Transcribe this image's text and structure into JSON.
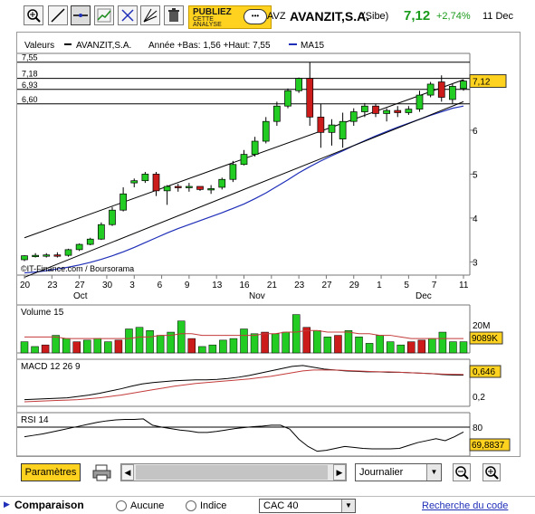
{
  "toolbar": {
    "tools": [
      {
        "name": "zoom-tool"
      },
      {
        "name": "line-tool"
      },
      {
        "name": "horizontal-line-tool"
      },
      {
        "name": "trend-tool"
      },
      {
        "name": "crosshair-tool"
      },
      {
        "name": "fibonacci-tool"
      },
      {
        "name": "delete-tool"
      }
    ],
    "publish_line1": "PUBLIEZ",
    "publish_line2": "CETTE",
    "publish_line3": "ANALYSE"
  },
  "stock": {
    "ticker": "AVZ",
    "name": "AVANZIT,S.A.",
    "market": "(Sibe)",
    "price": "7,12",
    "change": "+2,74%",
    "date": "11 Dec"
  },
  "colors": {
    "up_candle": "#22cc22",
    "down_candle": "#cc1b1b",
    "ma_line": "#1f2fb8",
    "channel_line": "#000000",
    "price_tag": "#ffd21f",
    "volume_ma": "#c43b3b",
    "macd_signal": "#c43b3b"
  },
  "price_panel": {
    "legend_valeurs": "Valeurs",
    "legend_series": "AVANZIT,S.A.",
    "legend_range": "Année +Bas: 1,56 +Haut: 7,55",
    "legend_ma": "MA15",
    "level_labels": [
      "7,55",
      "7,18",
      "6,93",
      "6,60"
    ],
    "y_ticks": [
      "6",
      "5",
      "4",
      "3"
    ],
    "price_tag": "7,12",
    "copyright": "©IT-Finance.com / Boursorama"
  },
  "x_axis": {
    "ticks": [
      "20",
      "23",
      "27",
      "30",
      "3",
      "6",
      "9",
      "13",
      "16",
      "21",
      "23",
      "27",
      "29",
      "1",
      "5",
      "7",
      "11"
    ],
    "months": [
      "Oct",
      "Nov",
      "Dec"
    ]
  },
  "chart_data": {
    "type": "candlestick",
    "title": "AVANZIT,S.A.",
    "candles": [
      {
        "o": 3.05,
        "h": 3.15,
        "l": 3.02,
        "c": 3.14
      },
      {
        "o": 3.14,
        "h": 3.2,
        "l": 3.1,
        "c": 3.15
      },
      {
        "o": 3.15,
        "h": 3.2,
        "l": 3.1,
        "c": 3.16
      },
      {
        "o": 3.16,
        "h": 3.22,
        "l": 3.1,
        "c": 3.15
      },
      {
        "o": 3.15,
        "h": 3.3,
        "l": 3.12,
        "c": 3.28
      },
      {
        "o": 3.28,
        "h": 3.42,
        "l": 3.25,
        "c": 3.4
      },
      {
        "o": 3.4,
        "h": 3.55,
        "l": 3.38,
        "c": 3.52
      },
      {
        "o": 3.52,
        "h": 3.9,
        "l": 3.5,
        "c": 3.85
      },
      {
        "o": 3.85,
        "h": 4.25,
        "l": 3.82,
        "c": 4.18
      },
      {
        "o": 4.18,
        "h": 4.7,
        "l": 4.15,
        "c": 4.55
      },
      {
        "o": 4.8,
        "h": 4.9,
        "l": 4.7,
        "c": 4.85
      },
      {
        "o": 4.85,
        "h": 5.05,
        "l": 4.8,
        "c": 5.0
      },
      {
        "o": 5.0,
        "h": 5.05,
        "l": 4.5,
        "c": 4.62
      },
      {
        "o": 4.62,
        "h": 4.75,
        "l": 4.3,
        "c": 4.72
      },
      {
        "o": 4.72,
        "h": 4.78,
        "l": 4.6,
        "c": 4.71
      },
      {
        "o": 4.71,
        "h": 4.8,
        "l": 4.6,
        "c": 4.72
      },
      {
        "o": 4.72,
        "h": 4.72,
        "l": 4.62,
        "c": 4.65
      },
      {
        "o": 4.65,
        "h": 4.75,
        "l": 4.55,
        "c": 4.67
      },
      {
        "o": 4.7,
        "h": 4.92,
        "l": 4.65,
        "c": 4.88
      },
      {
        "o": 4.88,
        "h": 5.3,
        "l": 4.82,
        "c": 5.22
      },
      {
        "o": 5.22,
        "h": 5.55,
        "l": 5.2,
        "c": 5.45
      },
      {
        "o": 5.45,
        "h": 5.85,
        "l": 5.4,
        "c": 5.75
      },
      {
        "o": 5.75,
        "h": 6.3,
        "l": 5.7,
        "c": 6.2
      },
      {
        "o": 6.2,
        "h": 6.65,
        "l": 6.1,
        "c": 6.55
      },
      {
        "o": 6.55,
        "h": 6.95,
        "l": 6.5,
        "c": 6.9
      },
      {
        "o": 6.9,
        "h": 7.2,
        "l": 6.85,
        "c": 7.18
      },
      {
        "o": 7.18,
        "h": 7.55,
        "l": 6.1,
        "c": 6.3
      },
      {
        "o": 6.3,
        "h": 6.6,
        "l": 5.6,
        "c": 5.95
      },
      {
        "o": 5.95,
        "h": 6.25,
        "l": 5.65,
        "c": 6.12
      },
      {
        "o": 5.8,
        "h": 6.4,
        "l": 5.6,
        "c": 6.2
      },
      {
        "o": 6.2,
        "h": 6.5,
        "l": 6.1,
        "c": 6.42
      },
      {
        "o": 6.42,
        "h": 6.62,
        "l": 6.3,
        "c": 6.55
      },
      {
        "o": 6.55,
        "h": 6.6,
        "l": 6.3,
        "c": 6.38
      },
      {
        "o": 6.38,
        "h": 6.5,
        "l": 6.2,
        "c": 6.45
      },
      {
        "o": 6.45,
        "h": 6.55,
        "l": 6.3,
        "c": 6.4
      },
      {
        "o": 6.4,
        "h": 6.55,
        "l": 6.35,
        "c": 6.48
      },
      {
        "o": 6.48,
        "h": 6.9,
        "l": 6.42,
        "c": 6.8
      },
      {
        "o": 6.8,
        "h": 7.1,
        "l": 6.75,
        "c": 7.05
      },
      {
        "o": 7.1,
        "h": 7.25,
        "l": 6.65,
        "c": 6.75
      },
      {
        "o": 6.7,
        "h": 7.05,
        "l": 6.6,
        "c": 7.0
      },
      {
        "o": 6.95,
        "h": 7.15,
        "l": 6.9,
        "c": 7.12
      }
    ],
    "ma15": [
      2.75,
      2.77,
      2.8,
      2.84,
      2.88,
      2.93,
      2.99,
      3.06,
      3.14,
      3.23,
      3.33,
      3.44,
      3.55,
      3.66,
      3.76,
      3.85,
      3.94,
      4.03,
      4.12,
      4.22,
      4.32,
      4.44,
      4.57,
      4.72,
      4.87,
      5.03,
      5.17,
      5.3,
      5.42,
      5.53,
      5.65,
      5.76,
      5.87,
      5.97,
      6.07,
      6.16,
      6.25,
      6.34,
      6.42,
      6.5,
      6.55
    ],
    "channel_lower": [
      [
        0,
        2.65
      ],
      [
        40,
        6.65
      ]
    ],
    "channel_upper": [
      [
        0,
        3.55
      ],
      [
        40,
        7.15
      ]
    ],
    "horizontal_levels": [
      7.55,
      7.18,
      6.93,
      6.6
    ],
    "ylim": [
      2.7,
      7.75
    ],
    "yticks": [
      3,
      4,
      5,
      6
    ]
  },
  "volume_panel": {
    "label": "Volume 15",
    "tick_label": "20M",
    "value_tag": "9089K",
    "values": [
      7,
      4,
      5,
      11,
      9,
      7,
      8,
      9,
      7,
      8,
      15,
      16,
      14,
      11,
      13,
      20,
      9,
      4,
      5,
      8,
      9,
      15,
      12,
      13,
      12,
      13,
      24,
      16,
      14,
      10,
      11,
      14,
      10,
      6,
      11,
      7,
      5,
      7,
      8,
      9,
      13,
      7,
      7
    ],
    "ma": [
      10,
      10,
      10,
      10,
      9,
      9,
      9,
      9,
      9,
      9,
      9,
      10,
      10,
      11,
      11,
      12,
      12,
      11,
      11,
      11,
      11,
      11,
      11,
      12,
      12,
      13,
      13,
      14,
      14,
      13,
      13,
      13,
      12,
      12,
      11,
      11,
      10,
      9,
      9,
      9,
      9,
      9,
      9
    ],
    "ymax": 30
  },
  "macd_panel": {
    "label": "MACD 12 26 9",
    "value_tag": "0,646",
    "tick_label": "0,2",
    "macd": [
      0.1,
      0.11,
      0.12,
      0.13,
      0.14,
      0.17,
      0.2,
      0.24,
      0.29,
      0.34,
      0.4,
      0.45,
      0.48,
      0.5,
      0.52,
      0.53,
      0.54,
      0.54,
      0.55,
      0.57,
      0.6,
      0.64,
      0.69,
      0.74,
      0.79,
      0.84,
      0.86,
      0.82,
      0.78,
      0.76,
      0.74,
      0.73,
      0.72,
      0.72,
      0.71,
      0.71,
      0.7,
      0.69,
      0.68,
      0.66,
      0.65,
      0.646
    ],
    "signal": [
      0.05,
      0.06,
      0.07,
      0.08,
      0.09,
      0.1,
      0.12,
      0.14,
      0.17,
      0.2,
      0.24,
      0.28,
      0.32,
      0.36,
      0.4,
      0.43,
      0.46,
      0.48,
      0.5,
      0.52,
      0.54,
      0.56,
      0.59,
      0.62,
      0.66,
      0.7,
      0.74,
      0.76,
      0.76,
      0.76,
      0.75,
      0.74,
      0.73,
      0.72,
      0.72,
      0.71,
      0.7,
      0.69,
      0.68,
      0.67,
      0.665,
      0.66
    ],
    "ymin": -0.05,
    "ymax": 1.0
  },
  "rsi_panel": {
    "label": "RSI 14",
    "level_label": "80",
    "value_tag": "69,8837",
    "values": [
      60,
      63,
      66,
      70,
      74,
      78,
      82,
      86,
      90,
      93,
      95,
      96,
      96,
      97,
      84,
      80,
      77,
      74,
      72,
      69,
      69,
      71,
      74,
      77,
      79,
      81,
      82,
      84,
      84,
      76,
      55,
      40,
      30,
      32,
      36,
      40,
      38,
      36,
      35,
      35,
      35,
      36,
      42,
      48,
      52,
      56,
      52,
      60,
      69.88
    ],
    "level": 80,
    "ymin": 20,
    "ymax": 110
  },
  "controls": {
    "params_label": "Paramètres",
    "period_value": "Journalier",
    "zoom_out": "zoom-out",
    "zoom_in": "zoom-in"
  },
  "comparison": {
    "label": "Comparaison",
    "option_none": "Aucune",
    "option_index": "Indice",
    "index_value": "CAC 40",
    "search_link": "Recherche du code"
  }
}
